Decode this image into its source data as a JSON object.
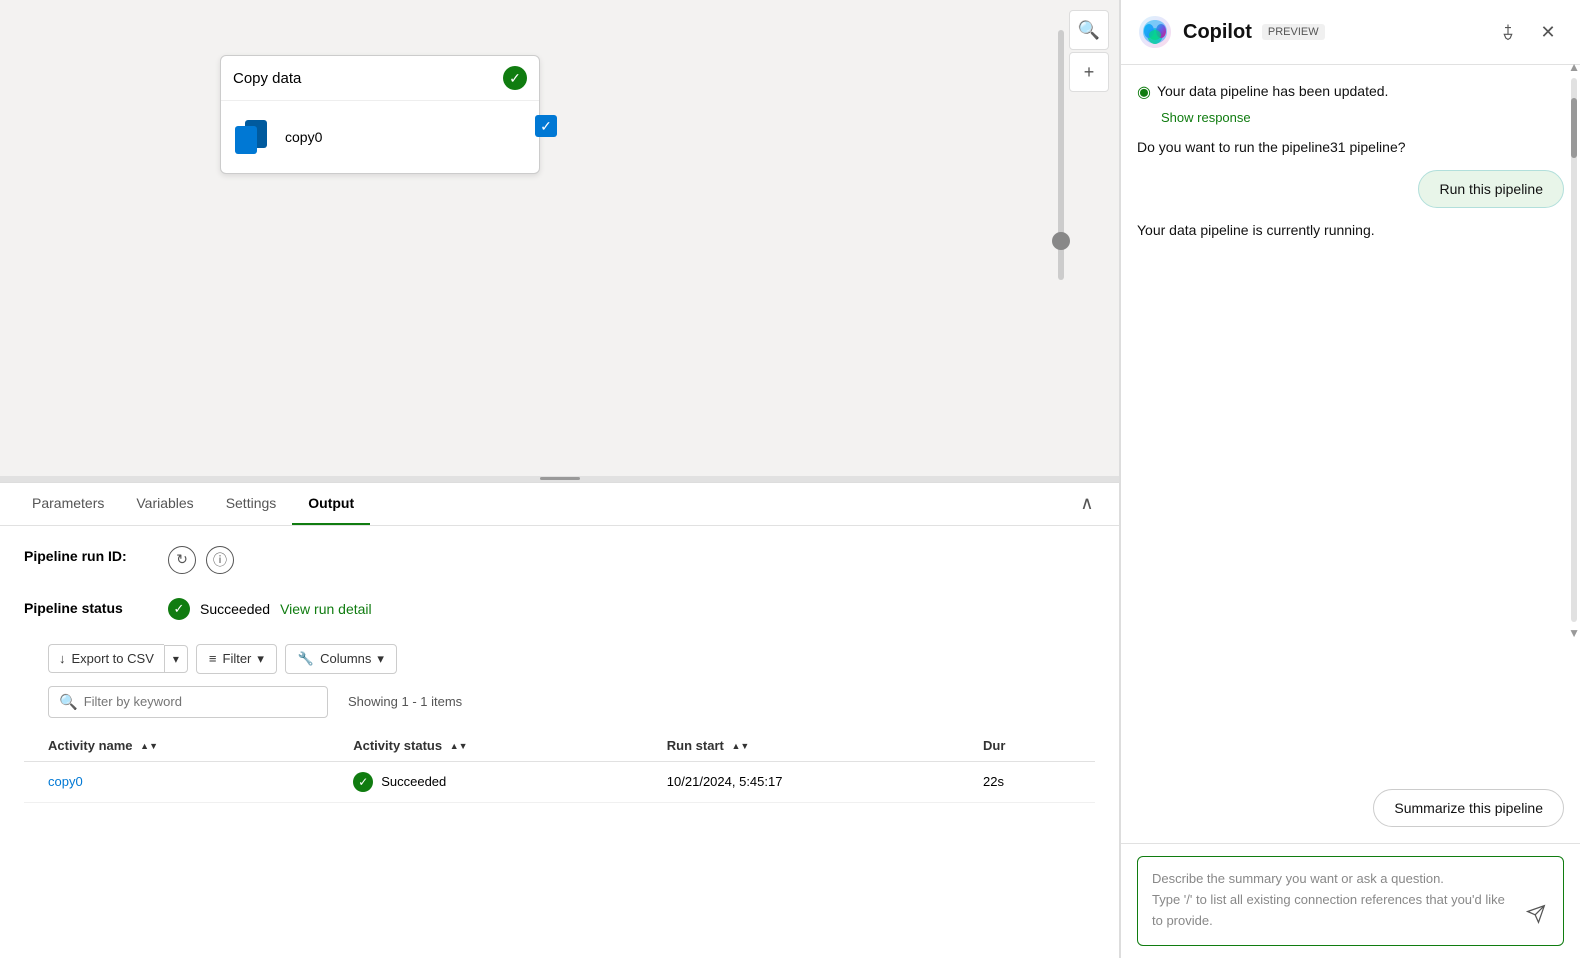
{
  "canvas": {
    "node": {
      "title": "Copy data",
      "activity_name": "copy0"
    }
  },
  "tabs": {
    "items": [
      {
        "label": "Parameters",
        "active": false
      },
      {
        "label": "Variables",
        "active": false
      },
      {
        "label": "Settings",
        "active": false
      },
      {
        "label": "Output",
        "active": true
      }
    ]
  },
  "output": {
    "pipeline_run_id_label": "Pipeline run ID:",
    "pipeline_status_label": "Pipeline status",
    "status_text": "Succeeded",
    "view_run_detail_label": "View run detail",
    "export_csv_label": "Export to CSV",
    "filter_placeholder": "Filter by keyword",
    "showing_text": "Showing 1 - 1 items",
    "columns": [
      {
        "label": "Activity name"
      },
      {
        "label": "Activity status"
      },
      {
        "label": "Run start"
      },
      {
        "label": "Dur"
      }
    ],
    "rows": [
      {
        "activity_name": "copy0",
        "activity_status": "Succeeded",
        "run_start": "10/21/2024, 5:45:17",
        "duration": "22s"
      }
    ]
  },
  "copilot": {
    "title": "Copilot",
    "preview_label": "PREVIEW",
    "messages": [
      {
        "type": "system-partial",
        "text": "Your data pipeline has been updated.",
        "show_response": "Show response"
      },
      {
        "type": "system",
        "text": "Do you want to run the pipeline31 pipeline?"
      },
      {
        "type": "suggestion-active",
        "text": "Run this pipeline"
      },
      {
        "type": "system",
        "text": "Your data pipeline is currently running."
      },
      {
        "type": "summarize-btn",
        "text": "Summarize this pipeline"
      }
    ],
    "input": {
      "placeholder_line1": "Describe the summary you want or ask a",
      "placeholder_line2": "question.",
      "placeholder_line3": "Type '/' to list all existing connection",
      "placeholder_line4": "references that you'd like to provide."
    }
  }
}
